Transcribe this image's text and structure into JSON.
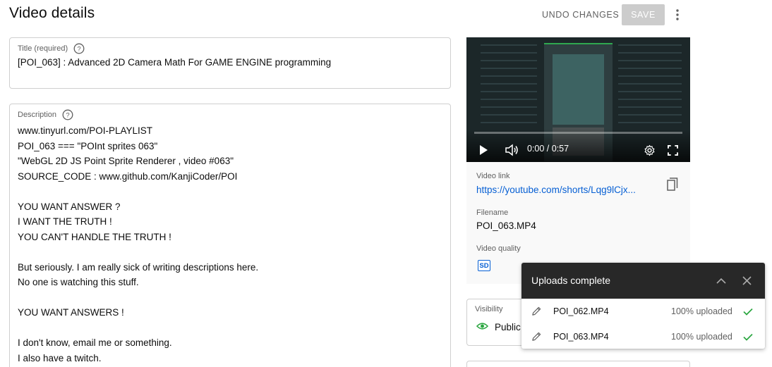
{
  "header": {
    "title": "Video details",
    "undo_label": "UNDO CHANGES",
    "save_label": "SAVE",
    "more_icon": "more-vert-icon"
  },
  "title_field": {
    "label": "Title (required)",
    "value": "[POI_063] : Advanced 2D Camera Math For GAME ENGINE programming"
  },
  "description_field": {
    "label": "Description",
    "lines": [
      "www.tinyurl.com/POI-PLAYLIST",
      "POI_063 === \"POInt sprites 063\"",
      "\"WebGL 2D JS Point Sprite Renderer , video #063\"",
      "SOURCE_CODE : www.github.com/KanjiCoder/POI",
      "",
      "YOU WANT ANSWER ?",
      "I WANT THE TRUTH !",
      "YOU CAN'T HANDLE THE TRUTH !",
      "",
      "But seriously. I am really sick of writing descriptions here.",
      "No one is watching this stuff.",
      "",
      "YOU WANT ANSWERS !",
      "",
      "I don't know, email me or something.",
      "I also have a twitch."
    ]
  },
  "video_panel": {
    "time": "0:00 / 0:57",
    "progress": 0,
    "video_link_label": "Video link",
    "video_link": "https://youtube.com/shorts/Lqg9lCjx...",
    "filename_label": "Filename",
    "filename": "POI_063.MP4",
    "quality_label": "Video quality",
    "quality_badge": "SD"
  },
  "visibility": {
    "label": "Visibility",
    "value": "Public"
  },
  "uploads_panel": {
    "title": "Uploads complete",
    "items": [
      {
        "name": "POI_062.MP4",
        "status": "100% uploaded"
      },
      {
        "name": "POI_063.MP4",
        "status": "100% uploaded"
      }
    ]
  },
  "colors": {
    "link": "#065fd4",
    "success": "#2ba640",
    "save_disabled": "#cccccc",
    "toast_header": "#282828"
  }
}
